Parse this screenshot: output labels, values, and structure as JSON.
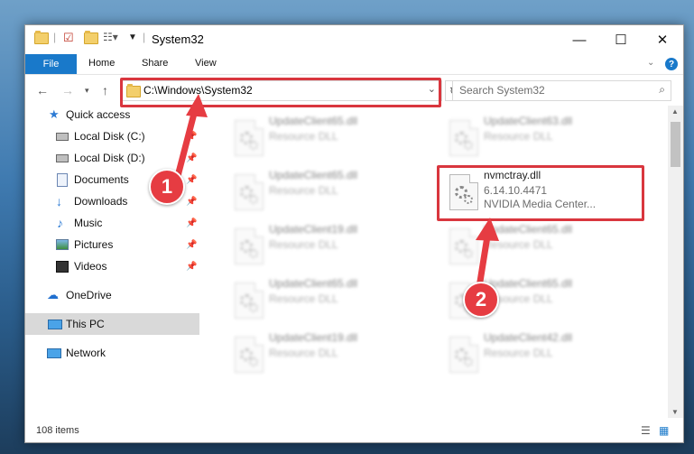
{
  "window": {
    "title": "System32",
    "minimize": "—",
    "maximize": "☐",
    "close": "✕"
  },
  "ribbon": {
    "tabs": [
      "File",
      "Home",
      "Share",
      "View"
    ]
  },
  "address": {
    "path": "C:\\Windows\\System32",
    "search_placeholder": "Search System32"
  },
  "nav": {
    "items": [
      {
        "label": "Quick access",
        "icon": "star-icon"
      },
      {
        "label": "Local Disk (C:)",
        "icon": "drive-icon",
        "pinned": true
      },
      {
        "label": "Local Disk (D:)",
        "icon": "drive-icon",
        "pinned": true
      },
      {
        "label": "Documents",
        "icon": "documents-icon",
        "pinned": true
      },
      {
        "label": "Downloads",
        "icon": "download-icon",
        "pinned": true
      },
      {
        "label": "Music",
        "icon": "music-icon",
        "pinned": true
      },
      {
        "label": "Pictures",
        "icon": "pictures-icon",
        "pinned": true
      },
      {
        "label": "Videos",
        "icon": "videos-icon",
        "pinned": true
      },
      {
        "label": "OneDrive",
        "icon": "cloud-icon"
      },
      {
        "label": "This PC",
        "icon": "computer-icon",
        "selected": true
      },
      {
        "label": "Network",
        "icon": "network-icon"
      }
    ]
  },
  "files": [
    {
      "name": "UpdateClient65.dll",
      "sub": "Resource DLL"
    },
    {
      "name": "UpdateClient63.dll",
      "sub": "Resource DLL"
    },
    {
      "name": "UpdateClient65.dll",
      "sub": "Resource DLL"
    },
    {
      "name": "nvmctray.dll",
      "sub": "6.14.10.4471",
      "sub2": "NVIDIA Media Center..."
    },
    {
      "name": "UpdateClient19.dll",
      "sub": "Resource DLL"
    },
    {
      "name": "UpdateClient65.dll",
      "sub": "Resource DLL"
    },
    {
      "name": "UpdateClient65.dll",
      "sub": "Resource DLL"
    },
    {
      "name": "UpdateClient65.dll",
      "sub": "Resource DLL"
    },
    {
      "name": "UpdateClient19.dll",
      "sub": "Resource DLL"
    },
    {
      "name": "UpdateClient42.dll",
      "sub": "Resource DLL"
    }
  ],
  "status": {
    "count": "108 items"
  },
  "annotations": {
    "step1": "1",
    "step2": "2",
    "color": "#e63c42"
  }
}
